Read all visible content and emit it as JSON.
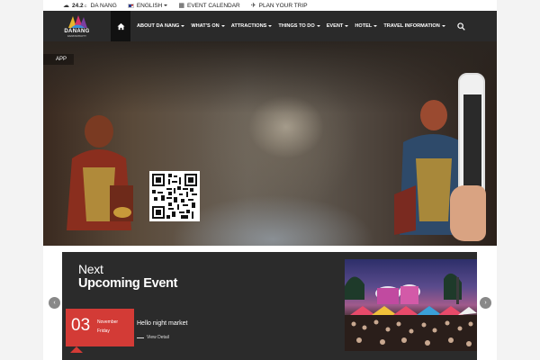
{
  "topbar": {
    "weather": {
      "icon": "weather-icon",
      "temperature": "24.2",
      "unit": "C",
      "city": "DA NANG"
    },
    "language": {
      "icon": "us-flag-icon",
      "label": "ENGLISH"
    },
    "calendar": {
      "icon": "calendar-icon",
      "label": "EVENT CALENDAR"
    },
    "plan": {
      "icon": "plane-icon",
      "label": "PLAN YOUR TRIP"
    }
  },
  "logo": {
    "name": "DANANG",
    "tagline": "FANTASTICITY"
  },
  "nav": {
    "items": [
      {
        "label": "ABOUT DA NANG"
      },
      {
        "label": "WHAT'S ON"
      },
      {
        "label": "ATTRACTIONS"
      },
      {
        "label": "THINGS TO DO"
      },
      {
        "label": "EVENT"
      },
      {
        "label": "HOTEL"
      },
      {
        "label": "TRAVEL INFORMATION"
      }
    ]
  },
  "hero": {
    "tag": "APP"
  },
  "events": {
    "heading_line1": "Next",
    "heading_line2": "Upcoming Event",
    "date": {
      "day": "03",
      "month": "November",
      "weekday": "Friday"
    },
    "title": "Hello night market",
    "link": "View Detail"
  },
  "colors": {
    "accent": "#d33b36",
    "nav_bg": "#2a2a2a",
    "panel_bg": "#2b2b2b"
  }
}
